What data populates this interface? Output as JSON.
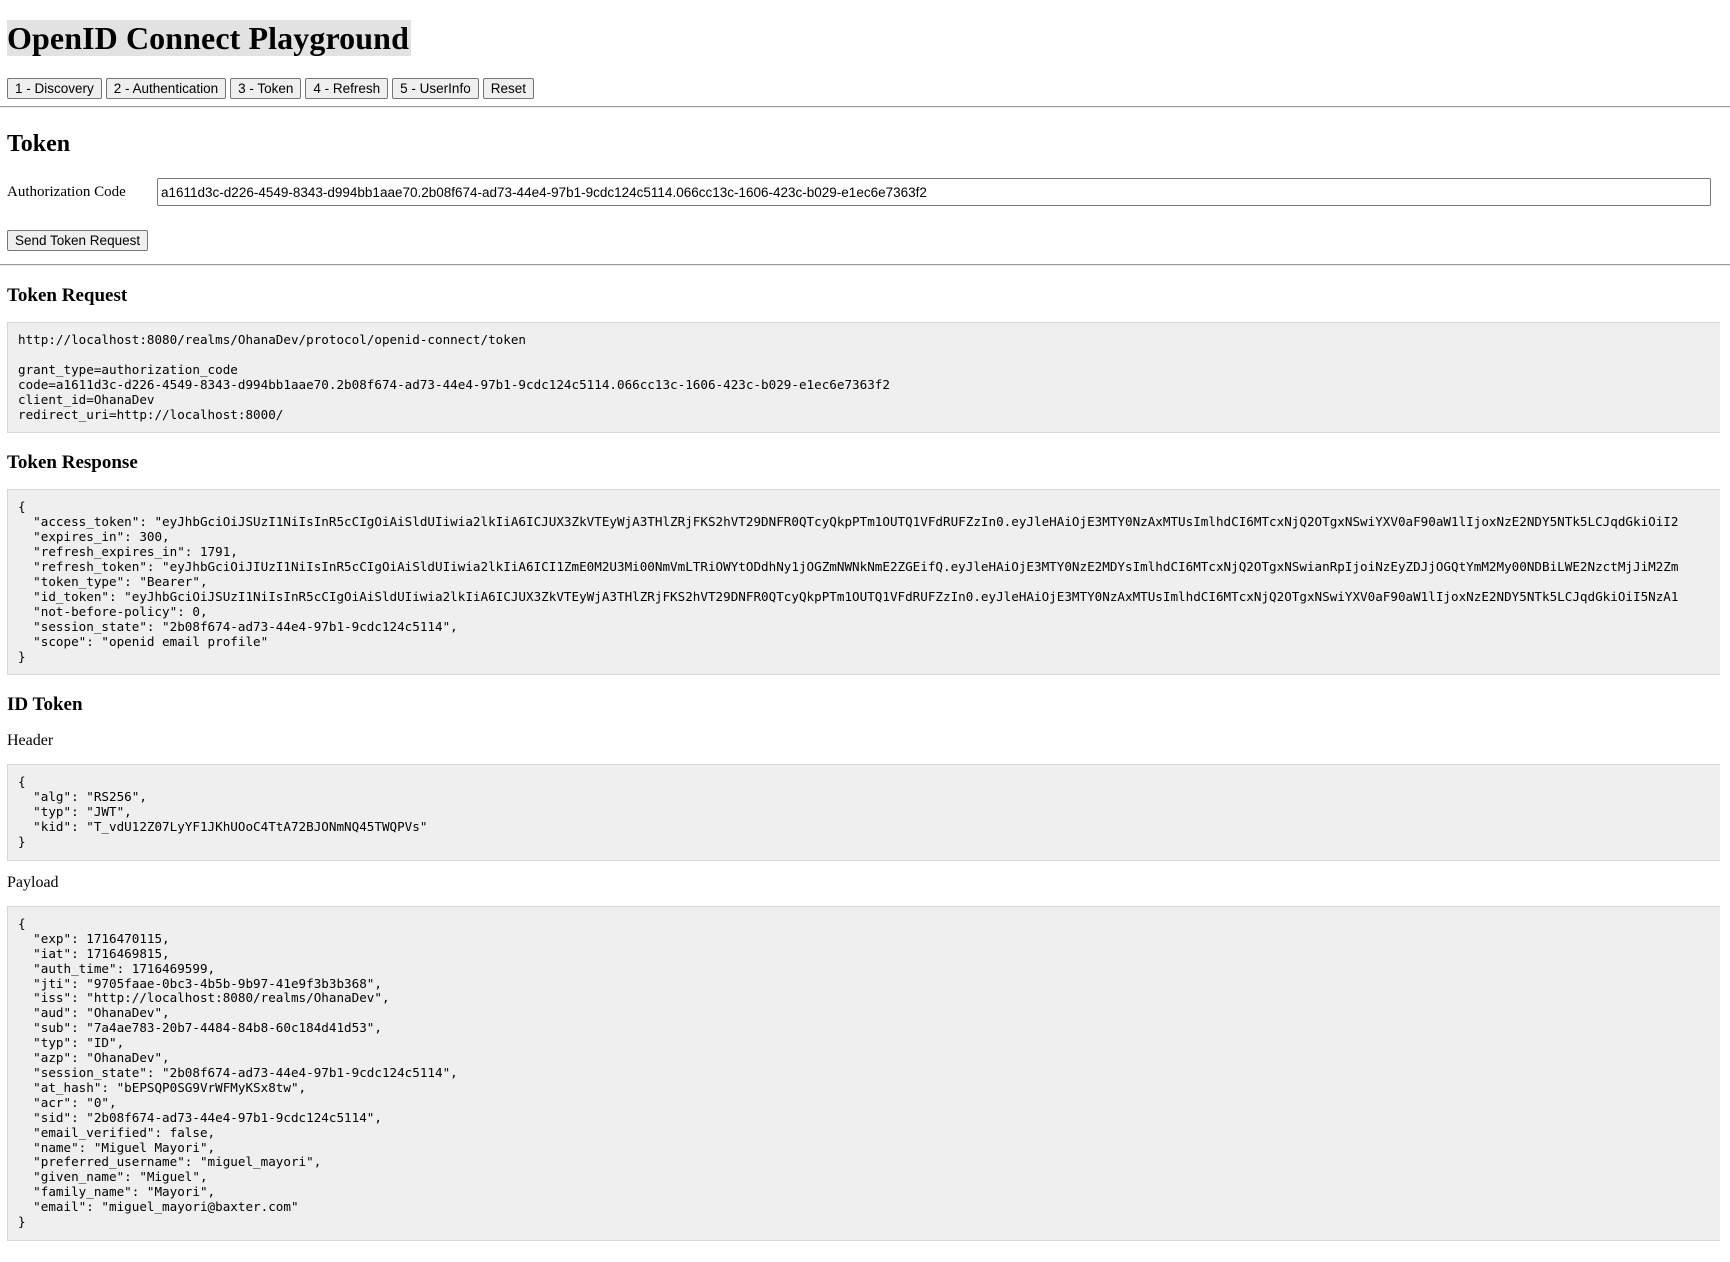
{
  "page": {
    "title": "OpenID Connect Playground"
  },
  "nav": {
    "buttons": [
      "1 - Discovery",
      "2 - Authentication",
      "3 - Token",
      "4 - Refresh",
      "5 - UserInfo",
      "Reset"
    ]
  },
  "token_section": {
    "title": "Token",
    "auth_code_label": "Authorization Code",
    "auth_code_value": "a1611d3c-d226-4549-8343-d994bb1aae70.2b08f674-ad73-44e4-97b1-9cdc124c5114.066cc13c-1606-423c-b029-e1ec6e7363f2",
    "send_button_label": "Send Token Request"
  },
  "token_request": {
    "title": "Token Request",
    "body": "http://localhost:8080/realms/OhanaDev/protocol/openid-connect/token\n\ngrant_type=authorization_code\ncode=a1611d3c-d226-4549-8343-d994bb1aae70.2b08f674-ad73-44e4-97b1-9cdc124c5114.066cc13c-1606-423c-b029-e1ec6e7363f2\nclient_id=OhanaDev\nredirect_uri=http://localhost:8000/"
  },
  "token_response": {
    "title": "Token Response",
    "body": "{\n  \"access_token\": \"eyJhbGciOiJSUzI1NiIsInR5cCIgOiAiSldUIiwia2lkIiA6ICJUX3ZkVTEyWjA3THlZRjFKS2hVT29DNFR0QTcyQkpPTm1OUTQ1VFdRUFZzIn0.eyJleHAiOjE3MTY0NzAxMTUsImlhdCI6MTcxNjQ2OTgxNSwiYXV0aF90aW1lIjoxNzE2NDY5NTk5LCJqdGkiOiI2\n  \"expires_in\": 300,\n  \"refresh_expires_in\": 1791,\n  \"refresh_token\": \"eyJhbGciOiJIUzI1NiIsInR5cCIgOiAiSldUIiwia2lkIiA6ICI1ZmE0M2U3Mi00NmVmLTRiOWYtODdhNy1jOGZmNWNkNmE2ZGEifQ.eyJleHAiOjE3MTY0NzE2MDYsImlhdCI6MTcxNjQ2OTgxNSwianRpIjoiNzEyZDJjOGQtYmM2My00NDBiLWE2NzctMjJiM2Zm\n  \"token_type\": \"Bearer\",\n  \"id_token\": \"eyJhbGciOiJSUzI1NiIsInR5cCIgOiAiSldUIiwia2lkIiA6ICJUX3ZkVTEyWjA3THlZRjFKS2hVT29DNFR0QTcyQkpPTm1OUTQ1VFdRUFZzIn0.eyJleHAiOjE3MTY0NzAxMTUsImlhdCI6MTcxNjQ2OTgxNSwiYXV0aF90aW1lIjoxNzE2NDY5NTk5LCJqdGkiOiI5NzA1\n  \"not-before-policy\": 0,\n  \"session_state\": \"2b08f674-ad73-44e4-97b1-9cdc124c5114\",\n  \"scope\": \"openid email profile\"\n}"
  },
  "id_token": {
    "title": "ID Token",
    "header_label": "Header",
    "header_body": "{\n  \"alg\": \"RS256\",\n  \"typ\": \"JWT\",\n  \"kid\": \"T_vdU12Z07LyYF1JKhUOoC4TtA72BJONmNQ45TWQPVs\"\n}",
    "payload_label": "Payload",
    "payload_body": "{\n  \"exp\": 1716470115,\n  \"iat\": 1716469815,\n  \"auth_time\": 1716469599,\n  \"jti\": \"9705faae-0bc3-4b5b-9b97-41e9f3b3b368\",\n  \"iss\": \"http://localhost:8080/realms/OhanaDev\",\n  \"aud\": \"OhanaDev\",\n  \"sub\": \"7a4ae783-20b7-4484-84b8-60c184d41d53\",\n  \"typ\": \"ID\",\n  \"azp\": \"OhanaDev\",\n  \"session_state\": \"2b08f674-ad73-44e4-97b1-9cdc124c5114\",\n  \"at_hash\": \"bEPSQP0SG9VrWFMyKSx8tw\",\n  \"acr\": \"0\",\n  \"sid\": \"2b08f674-ad73-44e4-97b1-9cdc124c5114\",\n  \"email_verified\": false,\n  \"name\": \"Miguel Mayori\",\n  \"preferred_username\": \"miguel_mayori\",\n  \"given_name\": \"Miguel\",\n  \"family_name\": \"Mayori\",\n  \"email\": \"miguel_mayori@baxter.com\"\n}"
  }
}
